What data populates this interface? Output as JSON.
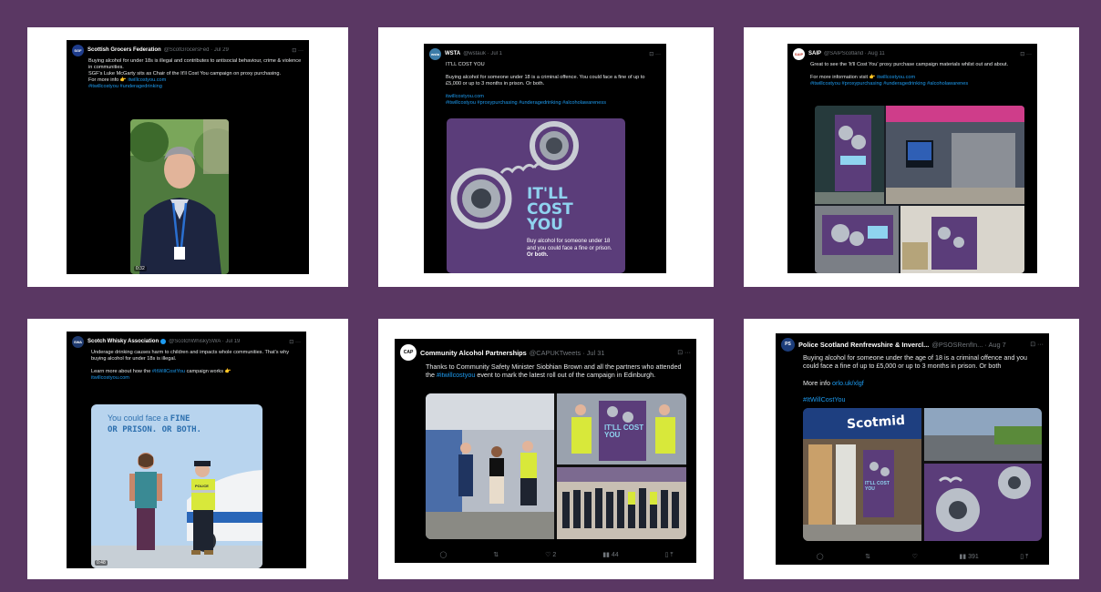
{
  "colors": {
    "background": "#5a3763",
    "card": "#ffffff",
    "tweet_bg": "#000000",
    "link": "#1d9bf0",
    "campaign_purple": "#5b3d7a"
  },
  "tweets": [
    {
      "author": "Scottish Grocers Federation",
      "handle": "@ScotGrocersFed · Jul 29",
      "avatar_text": "SGF",
      "lines": [
        "Buying alcohol for under 18s is illegal and contributes to antisocial behaviour, crime & violence in communities.",
        "SGF's Luke McGarty sits as Chair of the It'll Cost You campaign on proxy purchasing."
      ],
      "more_info": "For more info 👉",
      "link": "itwillcostyou.com",
      "hashtags": "#itwillcostyou #underagedrinking",
      "video_duration": "0:32"
    },
    {
      "author": "WSTA",
      "handle": "@wstauk · Jul 1",
      "avatar_text": "wsta",
      "title": "IT'LL COST YOU",
      "lines": [
        "Buying alcohol for someone under 18 is a criminal offence. You could face a fine of up to £5,000 or up to 3 months in prison. Or both."
      ],
      "link": "itwillcostyou.com",
      "hashtags": "#itwillcostyou #proxypurchasing #underagedrinking #alcoholawareness",
      "image_headline": "IT'LL COST YOU",
      "image_text": "Buy alcohol for someone under 18 and you could face a fine or prison.",
      "image_text_bold": "Or both."
    },
    {
      "author": "SAIP",
      "handle": "@SAIPScotland · Aug 11",
      "avatar_text": "SAIP",
      "lines": [
        "Great to see the 'It'll Cost You' proxy purchase  campaign materials whilst out and about."
      ],
      "more_info": "For more information visit 👉",
      "link": "itwillcostyou.com",
      "hashtags": "#itwillcostyou #proxypurchasing #underagedrinking #alcoholawarenes"
    },
    {
      "author": "Scotch Whisky Association",
      "handle": "@ScotchWhiskySWA · Jul 19",
      "avatar_text": "SWA",
      "lines": [
        "Underage drinking causes harm to children and impacts whole communities. That's why buying alcohol for under 18s is illegal."
      ],
      "more_info": "Learn more about how the",
      "hashtag_inline": "#ItWillCostYou",
      "more_info_tail": "campaign works 👉",
      "link": "itwillcostyou.com",
      "image_line1": "You could face a",
      "image_line1_bold": "FINE",
      "image_line2": "OR PRISON. OR BOTH.",
      "police_label": "POLICE",
      "car_text": "PO",
      "video_duration": "0:48"
    },
    {
      "author": "Community Alcohol Partnerships",
      "handle": "@CAPUKTweets · Jul 31",
      "avatar_text": "CAP",
      "text_before": "Thanks to Community Safety Minister Siobhian Brown and all the partners who attended the",
      "hashtag_inline": "#itwillcostyou",
      "text_after": "event to mark the latest roll out of the campaign in Edinburgh.",
      "poster_text": "IT'LL COST YOU",
      "actions": {
        "reply": "",
        "retweet": "",
        "likes": "2",
        "views": "44"
      }
    },
    {
      "author": "Police Scotland Renfrewshire & Invercl...",
      "handle": "@PSOSRenfIn... · Aug 7",
      "avatar_text": "PS",
      "lines": [
        "Buying alcohol for someone under the age of 18 is a criminal offence and you could face a fine of up to £5,000 or up to 3 months in prison. Or both"
      ],
      "more_info": "More info",
      "link": "orlo.uk/xlgf",
      "hashtags": "#ItWillCostYou",
      "store_sign": "Scotmid",
      "poster_text": "IT'LL COST YOU",
      "actions": {
        "reply": "",
        "retweet": "",
        "likes": "",
        "views": "391"
      }
    }
  ]
}
